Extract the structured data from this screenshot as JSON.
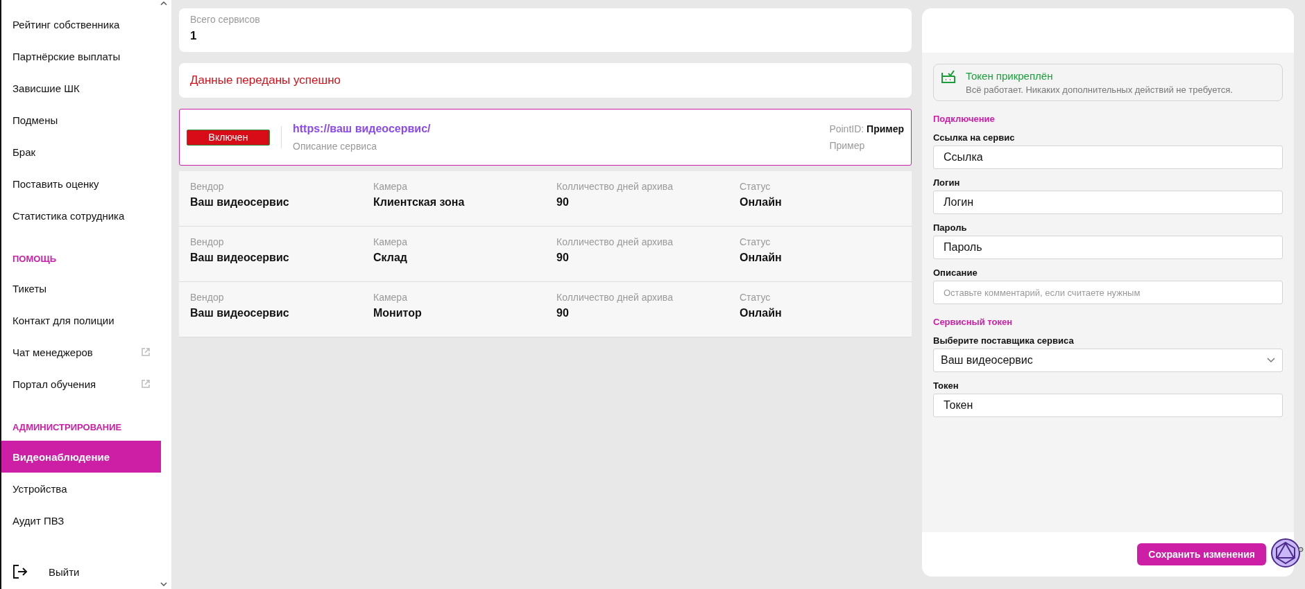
{
  "sidebar": {
    "items": [
      {
        "kind": "item",
        "label": "Рейтинг собственника",
        "selected": false,
        "external": false
      },
      {
        "kind": "item",
        "label": "Партнёрские выплаты",
        "selected": false,
        "external": false
      },
      {
        "kind": "item",
        "label": "Зависшие ШК",
        "selected": false,
        "external": false
      },
      {
        "kind": "item",
        "label": "Подмены",
        "selected": false,
        "external": false
      },
      {
        "kind": "item",
        "label": "Брак",
        "selected": false,
        "external": false
      },
      {
        "kind": "item",
        "label": "Поставить оценку",
        "selected": false,
        "external": false
      },
      {
        "kind": "item",
        "label": "Статистика сотрудника",
        "selected": false,
        "external": false
      },
      {
        "kind": "section",
        "label": "ПОМОЩЬ"
      },
      {
        "kind": "item",
        "label": "Тикеты",
        "selected": false,
        "external": false
      },
      {
        "kind": "item",
        "label": "Контакт для полиции",
        "selected": false,
        "external": false
      },
      {
        "kind": "item",
        "label": "Чат менеджеров",
        "selected": false,
        "external": true
      },
      {
        "kind": "item",
        "label": "Портал обучения",
        "selected": false,
        "external": true
      },
      {
        "kind": "section",
        "label": "АДМИНИСТРИРОВАНИЕ"
      },
      {
        "kind": "item",
        "label": "Видеонаблюдение",
        "selected": true,
        "external": false
      },
      {
        "kind": "item",
        "label": "Устройства",
        "selected": false,
        "external": false
      },
      {
        "kind": "item",
        "label": "Аудит ПВЗ",
        "selected": false,
        "external": false
      }
    ],
    "logout": "Выйти"
  },
  "summary": {
    "label": "Всего сервисов",
    "value": "1"
  },
  "message": "Данные переданы успешно",
  "service": {
    "selected": true,
    "status": "Включен",
    "url": "https://ваш видеосервис/",
    "description": "Описание сервиса",
    "point": "PointID: **Пример**",
    "extra": "Пример"
  },
  "cameras": [
    {
      "cells": [
        {
          "label": "Вендор",
          "value": "Ваш видеосервис"
        },
        {
          "label": "Камера",
          "value": "Клиентская зона"
        },
        {
          "label": "Колличество дней архива",
          "value": "90"
        },
        {
          "label": "Статус",
          "value": "Онлайн"
        }
      ]
    },
    {
      "cells": [
        {
          "label": "Вендор",
          "value": "Ваш видеосервис"
        },
        {
          "label": "Камера",
          "value": "Склад"
        },
        {
          "label": "Колличество дней архива",
          "value": "90"
        },
        {
          "label": "Статус",
          "value": "Онлайн"
        }
      ]
    },
    {
      "cells": [
        {
          "label": "Вендор",
          "value": "Ваш видеосервис"
        },
        {
          "label": "Камера",
          "value": "Монитор"
        },
        {
          "label": "Колличество дней архива",
          "value": "90"
        },
        {
          "label": "Статус",
          "value": "Онлайн"
        }
      ]
    }
  ],
  "panel": {
    "notice": {
      "title": "Токен прикреплён",
      "text": "Всё работает. Никаких дополнительных действий не требуется."
    },
    "form": [
      {
        "kind": "heading",
        "label": "Подключение"
      },
      {
        "kind": "input",
        "label": "Ссылка на сервис",
        "value": "Ссылка"
      },
      {
        "kind": "input",
        "label": "Логин",
        "value": "Логин"
      },
      {
        "kind": "input",
        "label": "Пароль",
        "value": "Пароль"
      },
      {
        "kind": "input",
        "label": "Описание",
        "placeholder": "Оставьте комментарий, если считаете нужным"
      },
      {
        "kind": "heading",
        "label": "Сервисный токен"
      },
      {
        "kind": "select",
        "label": "Выберите поставщика сервиса",
        "value": "Ваш видеосервис"
      },
      {
        "kind": "input",
        "label": "Токен",
        "value": "Токен"
      }
    ],
    "save": "Сохранить изменения"
  }
}
